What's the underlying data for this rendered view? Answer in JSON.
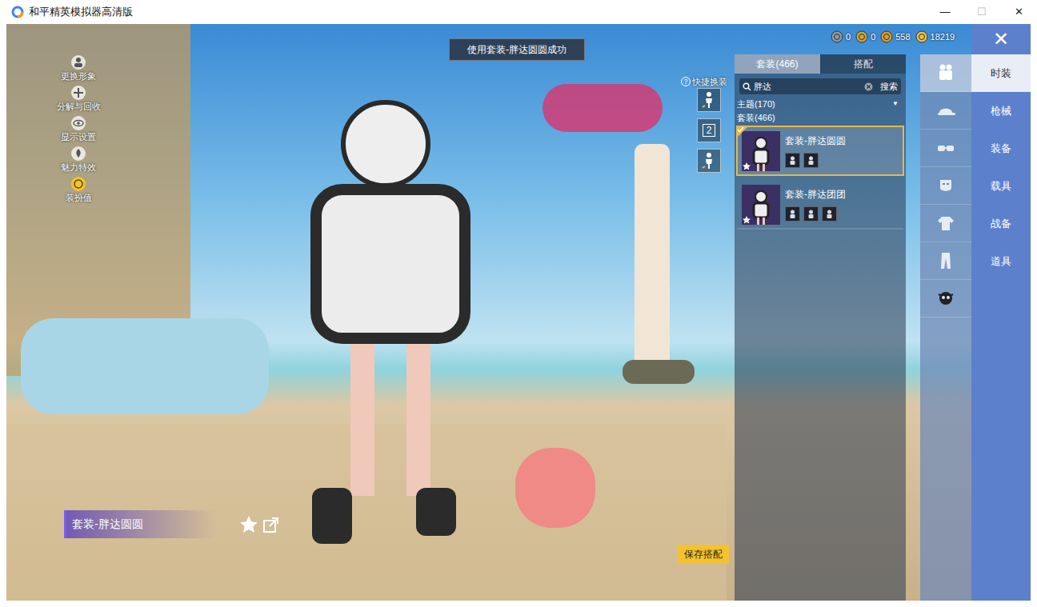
{
  "window": {
    "title": "和平精英模拟器高清版",
    "controls": [
      "—",
      "☐",
      "✕"
    ]
  },
  "toast": "使用套装-胖达圆圆成功",
  "currencies": [
    "0",
    "0",
    "558",
    "18219"
  ],
  "close": "✕",
  "left_menu": [
    {
      "label": "更换形象"
    },
    {
      "label": "分解与回收"
    },
    {
      "label": "显示设置"
    },
    {
      "label": "魅力特效"
    },
    {
      "label": "装扮值"
    }
  ],
  "quick_change": {
    "help": "?",
    "label": "快捷换装",
    "slots": [
      {
        "kind": "figure"
      },
      {
        "kind": "number",
        "text": "2"
      },
      {
        "kind": "figure"
      }
    ]
  },
  "panel": {
    "tabs": [
      {
        "label": "套装(466)",
        "selected": true
      },
      {
        "label": "搭配",
        "selected": false
      }
    ],
    "search": {
      "value": "胖达",
      "button": "搜索"
    },
    "filter": {
      "label": "主题(170)",
      "arrow": "▼"
    },
    "section": "套装(466)",
    "items": [
      {
        "name": "套装-胖达圆圆",
        "selected": true,
        "equipped": true,
        "parts": 2
      },
      {
        "name": "套装-胖达团团",
        "selected": false,
        "equipped": false,
        "parts": 3
      }
    ]
  },
  "icon_tabs": [
    {
      "kind": "suit",
      "selected": true
    },
    {
      "kind": "hat",
      "selected": false
    },
    {
      "kind": "glasses",
      "selected": false
    },
    {
      "kind": "mask",
      "selected": false
    },
    {
      "kind": "top",
      "selected": false
    },
    {
      "kind": "pants",
      "selected": false
    },
    {
      "kind": "pet",
      "selected": false
    }
  ],
  "categories": [
    {
      "label": "时装",
      "selected": true
    },
    {
      "label": "枪械",
      "selected": false
    },
    {
      "label": "装备",
      "selected": false
    },
    {
      "label": "载具",
      "selected": false
    },
    {
      "label": "战备",
      "selected": false
    },
    {
      "label": "道具",
      "selected": false
    }
  ],
  "preview": {
    "name": "套装-胖达圆圆"
  },
  "save_button": "保存搭配"
}
